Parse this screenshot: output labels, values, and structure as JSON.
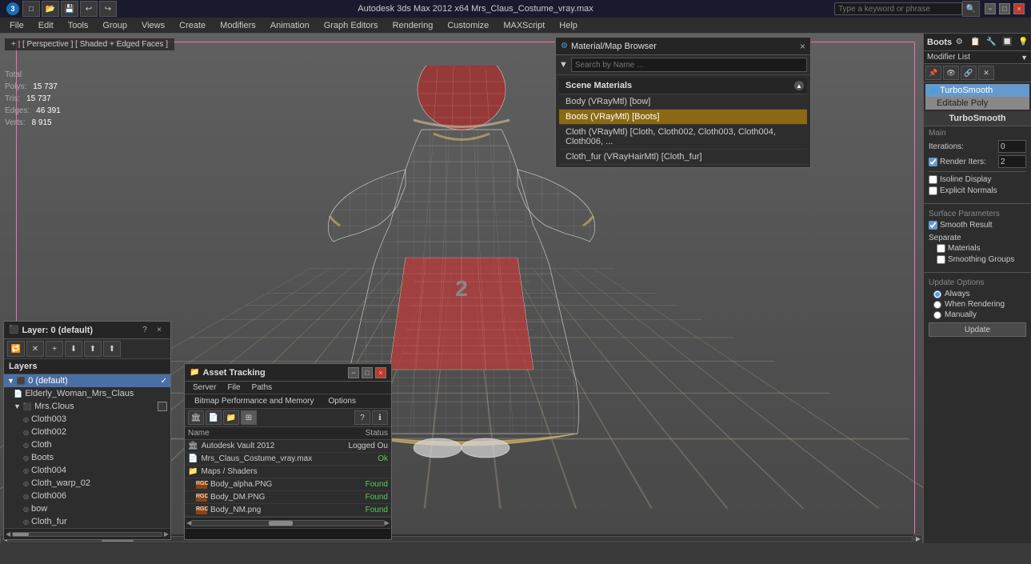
{
  "titlebar": {
    "left_icons": "🔵",
    "title": "Autodesk 3ds Max 2012 x64    Mrs_Claus_Costume_vray.max",
    "search_placeholder": "Type a keyword or phrase",
    "min_label": "−",
    "max_label": "□",
    "close_label": "×"
  },
  "menubar": {
    "items": [
      "File",
      "Edit",
      "Tools",
      "Group",
      "Views",
      "Create",
      "Modifiers",
      "Animation",
      "Graph Editors",
      "Rendering",
      "Customize",
      "MAXScript",
      "Help"
    ]
  },
  "viewport": {
    "label": "+ | [ Perspective ] [ Shaded + Edged Faces ]",
    "stats": {
      "total_label": "Total",
      "polys_label": "Polys:",
      "polys_value": "15 737",
      "tris_label": "Tris:",
      "tris_value": "15 737",
      "edges_label": "Edges:",
      "edges_value": "46 391",
      "verts_label": "Verts:",
      "verts_value": "8 915"
    },
    "number": "2"
  },
  "right_panel": {
    "title": "Boots",
    "modifier_list_label": "Modifier List",
    "modifiers": [
      {
        "name": "TurboSmooth",
        "selected": true
      },
      {
        "name": "Editable Poly",
        "selected": false
      }
    ],
    "turbosmooth": {
      "title": "TurboSmooth",
      "main_label": "Main",
      "iterations_label": "Iterations:",
      "iterations_value": "0",
      "render_iters_label": "Render Iters:",
      "render_iters_value": "2",
      "render_iters_checked": true,
      "isoline_display_label": "Isoline Display",
      "explicit_normals_label": "Explicit Normals",
      "surface_params_label": "Surface Parameters",
      "smooth_result_label": "Smooth Result",
      "smooth_result_checked": true,
      "separate_label": "Separate",
      "materials_label": "Materials",
      "smoothing_groups_label": "Smoothing Groups",
      "update_options_label": "Update Options",
      "always_label": "Always",
      "when_rendering_label": "When Rendering",
      "manually_label": "Manually",
      "update_btn": "Update"
    }
  },
  "material_browser": {
    "title": "Material/Map Browser",
    "search_placeholder": "Search by Name ...",
    "scene_materials_label": "Scene Materials",
    "items": [
      {
        "name": "Body (VRayMtl) [bow]",
        "selected": false
      },
      {
        "name": "Boots (VRayMtl) [Boots]",
        "selected": true
      },
      {
        "name": "Cloth (VRayMtl) [Cloth, Cloth002, Cloth003, Cloth004, Cloth006, ...",
        "selected": false
      },
      {
        "name": "Cloth_fur (VRayHairMtl) [Cloth_fur]",
        "selected": false
      }
    ]
  },
  "layers_panel": {
    "title": "Layer: 0 (default)",
    "help_label": "?",
    "close_label": "×",
    "toolbar": {
      "btns": [
        "🔁",
        "✕",
        "+",
        "⬇",
        "⬆",
        "⬆⬆"
      ]
    },
    "label": "Layers",
    "items": [
      {
        "name": "0 (default)",
        "level": 0,
        "selected": true,
        "has_check": true
      },
      {
        "name": "Elderly_Woman_Mrs_Claus",
        "level": 1,
        "selected": false
      },
      {
        "name": "Mrs.Clous",
        "level": 1,
        "selected": false,
        "has_check": true
      },
      {
        "name": "Cloth003",
        "level": 2,
        "selected": false
      },
      {
        "name": "Cloth002",
        "level": 2,
        "selected": false
      },
      {
        "name": "Cloth",
        "level": 2,
        "selected": false
      },
      {
        "name": "Boots",
        "level": 2,
        "selected": false
      },
      {
        "name": "Cloth004",
        "level": 2,
        "selected": false
      },
      {
        "name": "Cloth_warp_02",
        "level": 2,
        "selected": false
      },
      {
        "name": "Cloth006",
        "level": 2,
        "selected": false
      },
      {
        "name": "bow",
        "level": 2,
        "selected": false
      },
      {
        "name": "Cloth_fur",
        "level": 2,
        "selected": false
      }
    ]
  },
  "asset_tracking": {
    "title": "Asset Tracking",
    "min_label": "−",
    "max_label": "□",
    "close_label": "×",
    "menu": [
      "Server",
      "File",
      "Paths"
    ],
    "submenu": [
      "Bitmap Performance and Memory",
      "Options"
    ],
    "table": {
      "col_name": "Name",
      "col_status": "Status",
      "rows": [
        {
          "icon": "🏛",
          "name": "Autodesk Vault 2012",
          "status": "Logged Ou"
        },
        {
          "icon": "📄",
          "name": "Mrs_Claus_Costume_vray.max",
          "status": "Ok"
        },
        {
          "icon": "📁",
          "name": "Maps / Shaders",
          "status": ""
        },
        {
          "icon": "🖼",
          "name": "Body_alpha.PNG",
          "status": "Found"
        },
        {
          "icon": "🖼",
          "name": "Body_DM.PNG",
          "status": "Found"
        },
        {
          "icon": "🖼",
          "name": "Body_NM.png",
          "status": "Found"
        }
      ]
    }
  },
  "icons": {
    "search": "🔍",
    "gear": "⚙",
    "close": "×",
    "minimize": "−",
    "maximize": "□",
    "folder": "📁",
    "file": "📄",
    "image": "🖼",
    "vault": "🏛",
    "arrow_left": "◀",
    "arrow_right": "▶",
    "check": "✓"
  }
}
